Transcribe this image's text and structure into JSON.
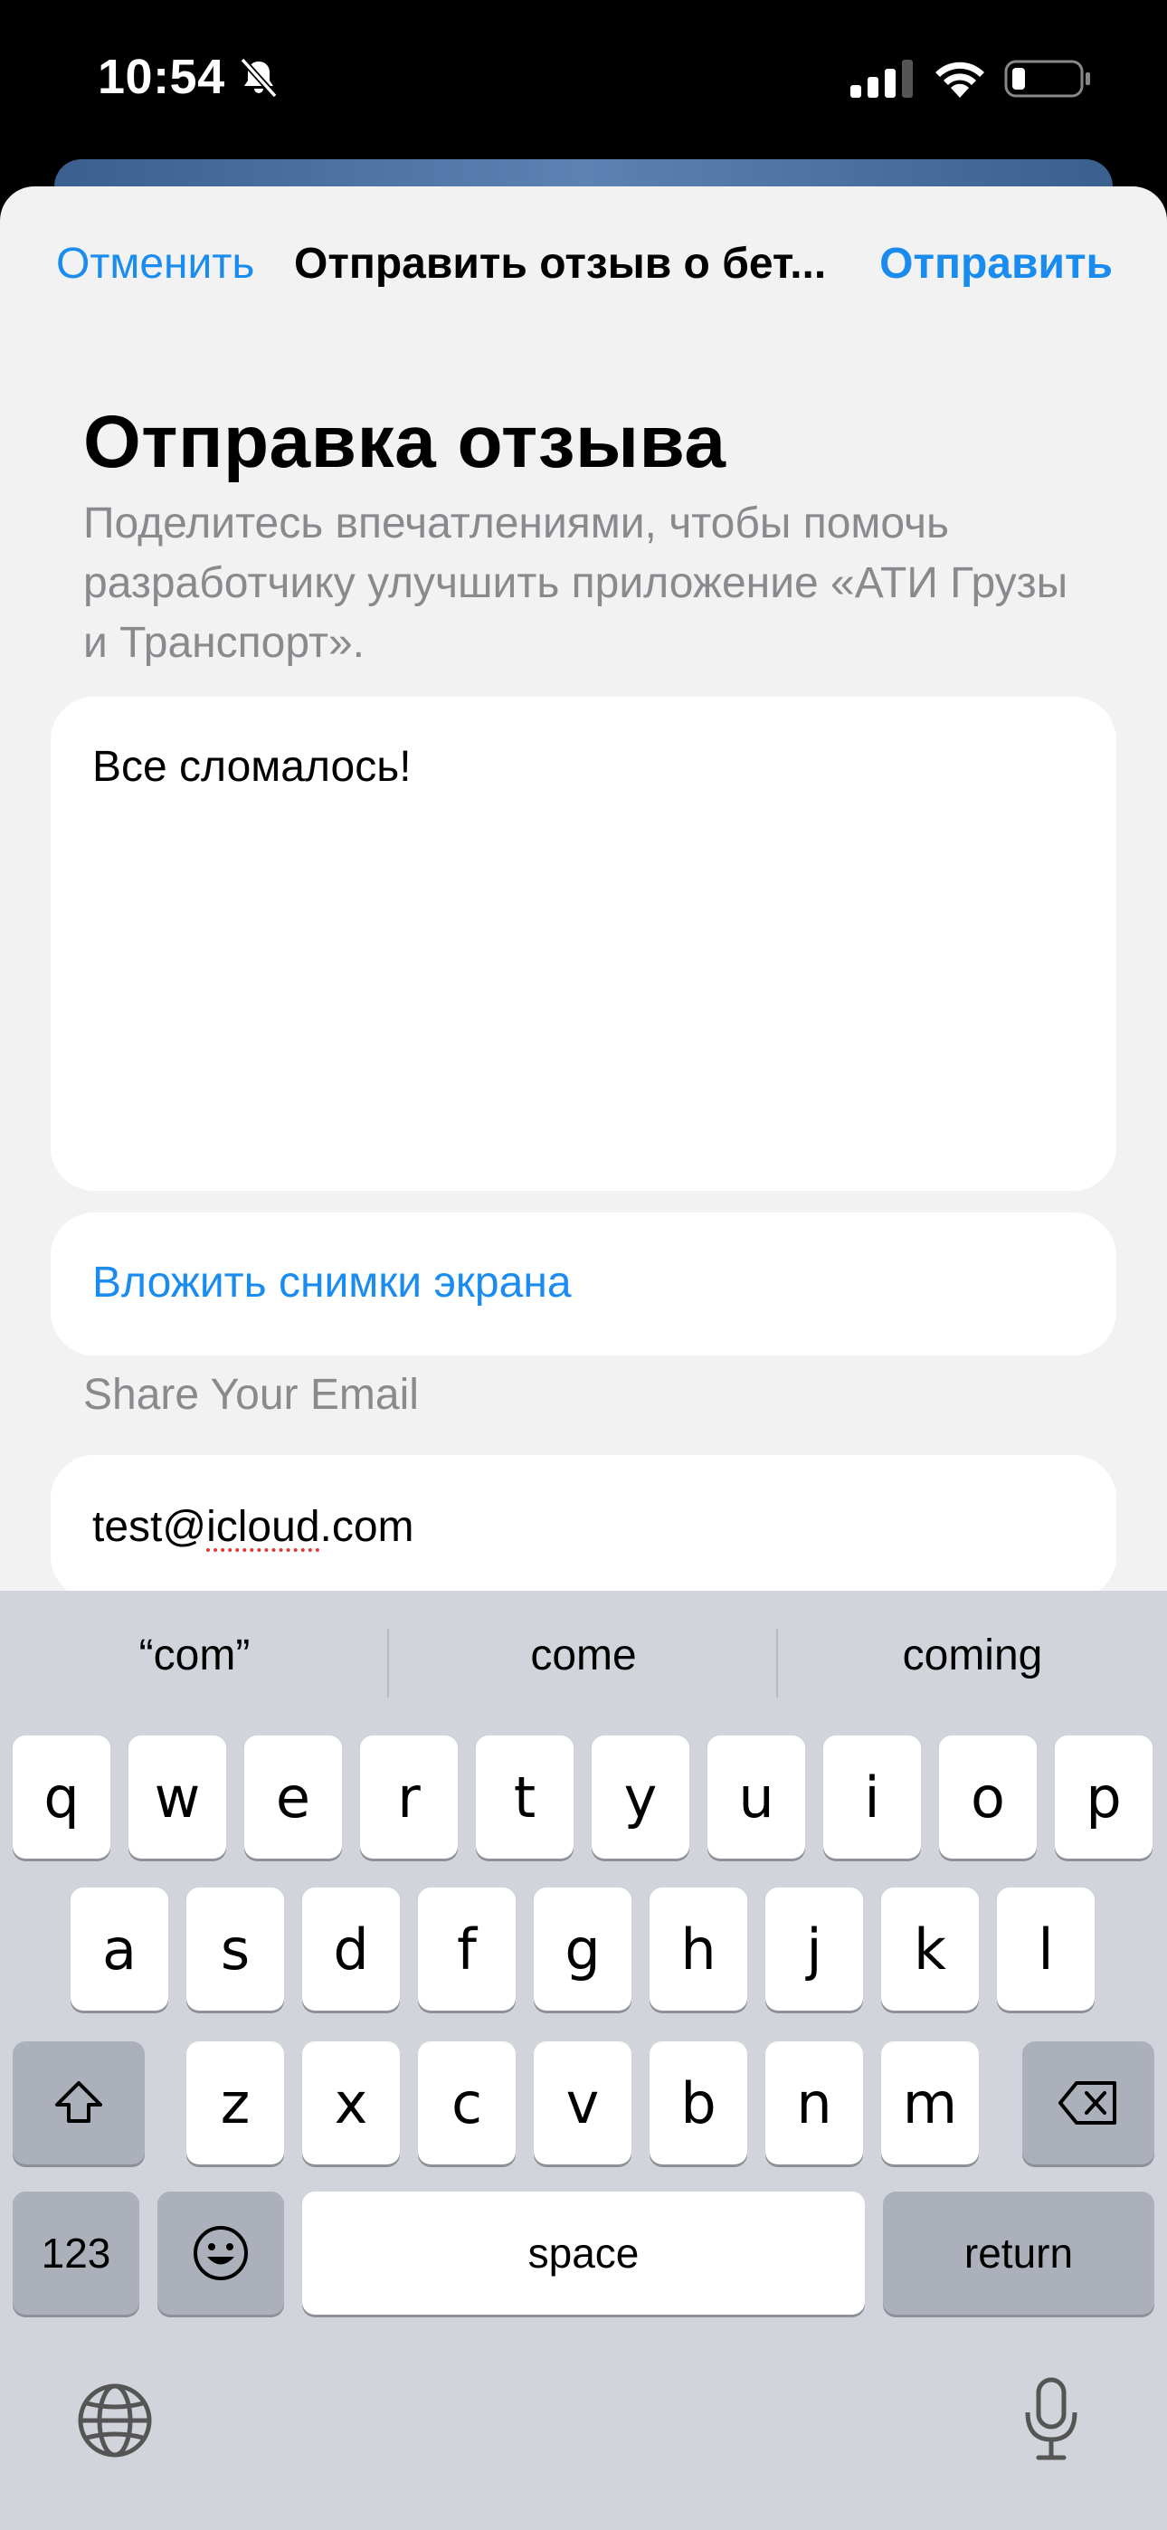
{
  "status_bar": {
    "time": "10:54"
  },
  "nav": {
    "cancel_label": "Отменить",
    "title": "Отправить отзыв о бет...",
    "send_label": "Отправить"
  },
  "form": {
    "title": "Отправка отзыва",
    "subtitle": "Поделитесь впечатлениями, чтобы помочь разработчику улучшить приложение «АТИ Грузы и Транспорт».",
    "feedback_text": "Все сломалось!",
    "attach_label": "Вложить снимки экрана",
    "email_section_label": "Share Your Email",
    "email_value_prefix": "test@",
    "email_value_misspelled": "icloud",
    "email_value_suffix": ".com"
  },
  "keyboard": {
    "suggestions": [
      "“com”",
      "come",
      "coming"
    ],
    "row1": [
      "q",
      "w",
      "e",
      "r",
      "t",
      "y",
      "u",
      "i",
      "o",
      "p"
    ],
    "row2": [
      "a",
      "s",
      "d",
      "f",
      "g",
      "h",
      "j",
      "k",
      "l"
    ],
    "row3": [
      "z",
      "x",
      "c",
      "v",
      "b",
      "n",
      "m"
    ],
    "numbers_label": "123",
    "space_label": "space",
    "return_label": "return"
  },
  "colors": {
    "accent": "#1a8cf0",
    "sheet_background": "#f2f2f2",
    "keyboard_background": "#d1d4da"
  },
  "icons": [
    "bell-slash-icon",
    "signal-icon",
    "wifi-icon",
    "battery-icon",
    "shift-icon",
    "backspace-icon",
    "emoji-icon",
    "globe-icon",
    "microphone-icon"
  ]
}
